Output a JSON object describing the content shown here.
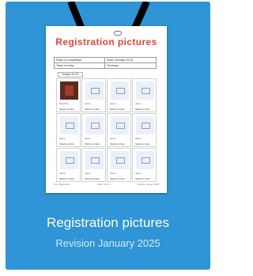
{
  "document": {
    "title": "Registration pictures",
    "info": [
      {
        "label": "Place of competition",
        "value": "Skien, Norway 29.05"
      },
      {
        "label": "Team /country",
        "value": "Germany"
      }
    ],
    "images_header": "Images for ID",
    "cell_name": "name",
    "cell_select": "Select an item",
    "first_cell_name": "Mcucxhe",
    "footer_left": "Title / Registration",
    "footer_mid": "Page: 1 from 1",
    "footer_right": "Revision: January 2025"
  },
  "card": {
    "name": "Registration pictures",
    "revision": "Revision January 2025"
  },
  "colors": {
    "card_bg": "#2f95d6",
    "title": "#e3443b"
  }
}
